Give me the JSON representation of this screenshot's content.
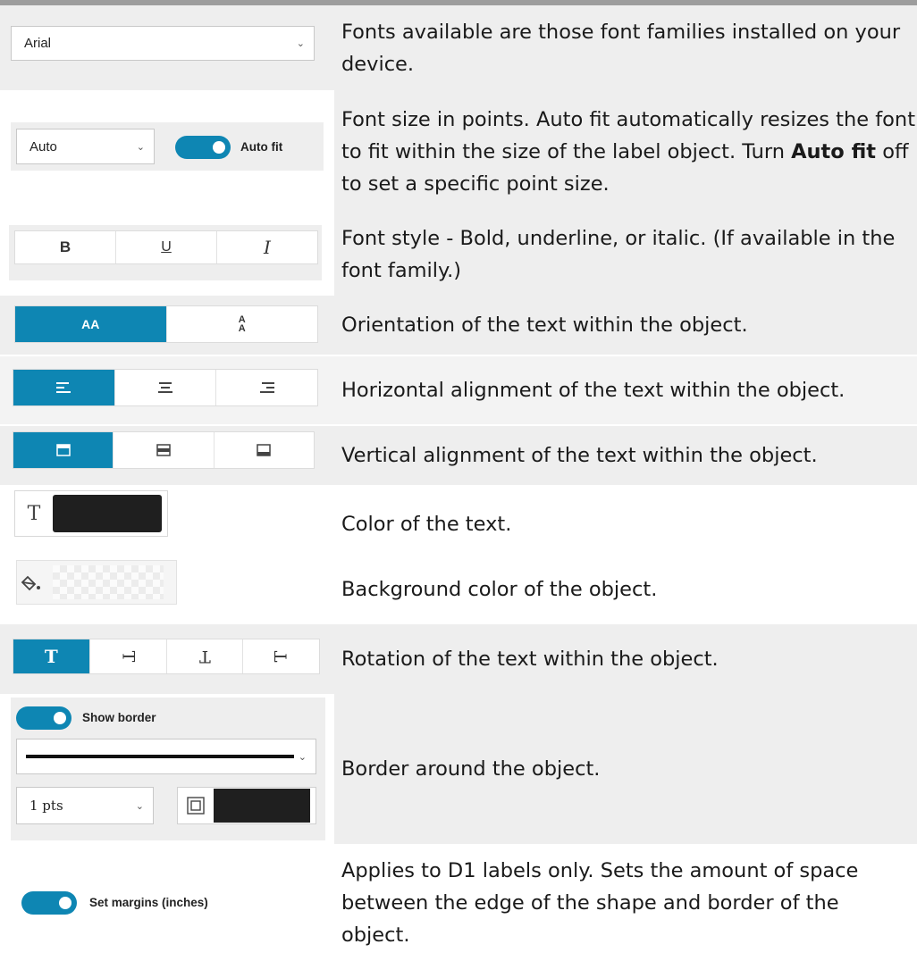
{
  "colors": {
    "accent": "#0e86b3",
    "row_shade": "#eeeeee",
    "swatch": "#1f1f1f",
    "topbar": "#9d9d9d"
  },
  "rows": {
    "font_family": {
      "select_value": "Arial",
      "description": "Fonts available are those font families installed on your device."
    },
    "font_size": {
      "select_value": "Auto",
      "toggle_label": "Auto fit",
      "description_pre": "Font size in points. Auto fit automatically resizes the font to fit within the size of the label object. Turn ",
      "description_bold": "Auto fit",
      "description_post": " off to set a specific point size."
    },
    "font_style": {
      "buttons": [
        "B",
        "U",
        "I"
      ],
      "description": "Font style - Bold, underline, or italic. (If available in the font family.)"
    },
    "orientation": {
      "buttons": [
        "AA",
        "A/A"
      ],
      "selected": "AA",
      "description": "Orientation of the text within the object."
    },
    "horizontal_alignment": {
      "icons": [
        "align-left-icon",
        "align-center-icon",
        "align-right-icon"
      ],
      "selected": "align-left-icon",
      "description": "Horizontal alignment of the text within the object."
    },
    "vertical_alignment": {
      "icons": [
        "align-top-icon",
        "align-middle-icon",
        "align-bottom-icon"
      ],
      "selected": "align-top-icon",
      "description": "Vertical alignment of the text within the object."
    },
    "text_color": {
      "icon": "text-color-icon",
      "glyph": "T",
      "swatch_color": "#1f1f1f",
      "description": "Color of the text."
    },
    "background_color": {
      "icon": "paint-bucket-icon",
      "swatch": "transparent",
      "description": "Background color of the object."
    },
    "rotation": {
      "glyph": "T",
      "icons": [
        "rotate-0-icon",
        "rotate-90-icon",
        "rotate-180-icon",
        "rotate-270-icon"
      ],
      "selected": "rotate-0-icon",
      "description": "Rotation of the text within the object."
    },
    "border": {
      "toggle_label": "Show border",
      "width_value": "1 pts",
      "swatch_color": "#1f1f1f",
      "description": "Border around the object."
    },
    "margins": {
      "toggle_label": "Set margins (inches)",
      "description": "Applies to D1 labels only. Sets the amount of space between the edge of the shape and border of the object."
    }
  }
}
